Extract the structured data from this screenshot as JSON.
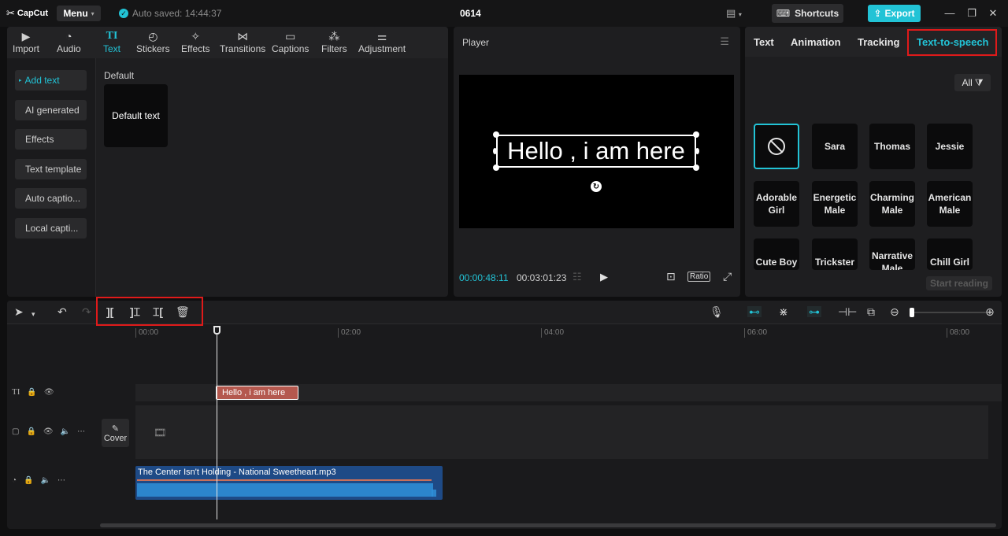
{
  "titlebar": {
    "logo": "CapCut",
    "menu_label": "Menu",
    "autosave": "Auto saved: 14:44:37",
    "project_name": "0614",
    "shortcuts_label": "Shortcuts",
    "export_label": "Export"
  },
  "media_tabs": [
    {
      "label": "Import",
      "icon": "import-icon"
    },
    {
      "label": "Audio",
      "icon": "audio-icon"
    },
    {
      "label": "Text",
      "icon": "text-icon",
      "active": true
    },
    {
      "label": "Stickers",
      "icon": "stickers-icon"
    },
    {
      "label": "Effects",
      "icon": "effects-icon"
    },
    {
      "label": "Transitions",
      "icon": "transitions-icon"
    },
    {
      "label": "Captions",
      "icon": "captions-icon"
    },
    {
      "label": "Filters",
      "icon": "filters-icon"
    },
    {
      "label": "Adjustment",
      "icon": "adjustment-icon"
    }
  ],
  "sidebar": {
    "items": [
      {
        "label": "Add text"
      },
      {
        "label": "AI generated"
      },
      {
        "label": "Effects"
      },
      {
        "label": "Text template"
      },
      {
        "label": "Auto captio..."
      },
      {
        "label": "Local capti..."
      }
    ]
  },
  "text_library": {
    "section_title": "Default",
    "card_label": "Default text"
  },
  "player": {
    "title": "Player",
    "overlay_text": "Hello , i am here",
    "current_time": "00:00:48:11",
    "total_time": "00:03:01:23",
    "ratio_label": "Ratio"
  },
  "right_tabs": {
    "text": "Text",
    "animation": "Animation",
    "tracking": "Tracking",
    "tts": "Text-to-speech"
  },
  "tts": {
    "filter_label": "All",
    "voices": [
      {
        "label": ""
      },
      {
        "label": "Sara"
      },
      {
        "label": "Thomas"
      },
      {
        "label": "Jessie"
      },
      {
        "label": "Adorable Girl"
      },
      {
        "label": "Energetic Male"
      },
      {
        "label": "Charming Male"
      },
      {
        "label": "American Male"
      },
      {
        "label": "Cute Boy"
      },
      {
        "label": "Trickster"
      },
      {
        "label": "Narrative Male"
      },
      {
        "label": "Chill Girl"
      }
    ],
    "start_reading_label": "Start reading"
  },
  "timeline": {
    "ruler_ticks": [
      "00:00",
      "02:00",
      "04:00",
      "06:00",
      "08:00"
    ],
    "cover_label": "Cover",
    "text_clip_label": "Hello , i am here",
    "audio_clip_label": "The Center Isn't Holding - National Sweetheart.mp3"
  },
  "colors": {
    "accent": "#22c3d6",
    "highlight": "#e01a1a",
    "text_clip": "#b4584e",
    "audio_clip": "#1e4a86"
  }
}
